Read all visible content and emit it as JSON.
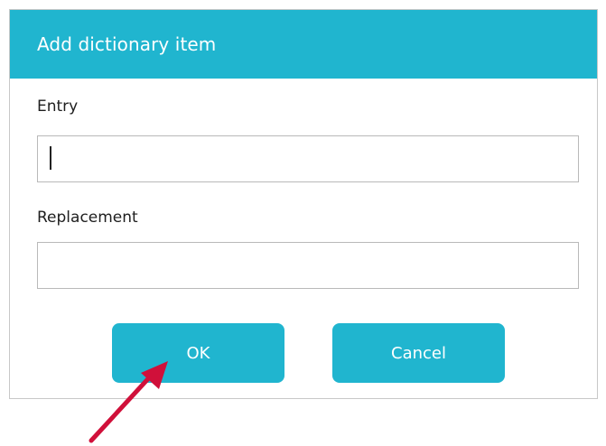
{
  "dialog": {
    "title": "Add dictionary item",
    "entry": {
      "label": "Entry",
      "value": "",
      "placeholder": ""
    },
    "replacement": {
      "label": "Replacement",
      "value": "",
      "placeholder": ""
    },
    "buttons": {
      "ok_label": "OK",
      "cancel_label": "Cancel"
    }
  },
  "annotation": {
    "icon": "arrow-pointer",
    "color": "#d0103a"
  },
  "colors": {
    "accent": "#20b5cf",
    "text": "#1e1e1e",
    "border": "#b9b9b9"
  }
}
